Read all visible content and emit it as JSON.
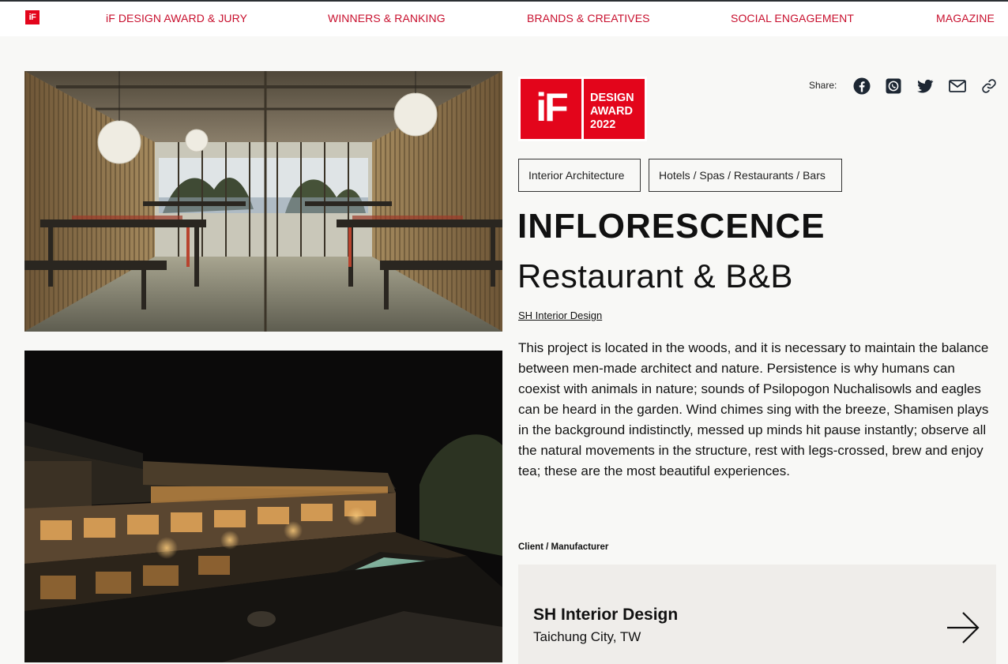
{
  "nav": {
    "logo": "iF",
    "items": [
      {
        "label": "iF DESIGN AWARD & JURY"
      },
      {
        "label": "WINNERS & RANKING"
      },
      {
        "label": "BRANDS & CREATIVES"
      },
      {
        "label": "SOCIAL ENGAGEMENT"
      },
      {
        "label": "MAGAZINE"
      }
    ]
  },
  "award": {
    "mark": "iF",
    "line1": "DESIGN",
    "line2": "AWARD",
    "line3": "2022"
  },
  "share": {
    "label": "Share:",
    "icons": [
      "facebook-icon",
      "whatsapp-icon",
      "twitter-icon",
      "mail-icon",
      "link-icon"
    ]
  },
  "tags": [
    "Interior Architecture",
    "Hotels / Spas / Restaurants / Bars"
  ],
  "project": {
    "title": "INFLORESCENCE",
    "subtitle": "Restaurant & B&B",
    "designer": "SH Interior Design",
    "description": "This project is located in the woods, and it is necessary to maintain the balance between men-made architect and nature. Persistence is why humans can coexist with animals in nature; sounds of Psilopogon Nuchalisowls and eagles can be heard in the garden. Wind chimes sing with the breeze, Shamisen plays in the background indistinctly, messed up minds hit pause instantly; observe all the natural movements in the structure, rest with legs-crossed, brew and enjoy tea; these are the most beautiful experiences."
  },
  "client": {
    "label": "Client / Manufacturer",
    "name": "SH Interior Design",
    "location": "Taichung City, TW"
  },
  "colors": {
    "brand": "#e3051b",
    "nav_link": "#c8102e",
    "background": "#f8f8f6",
    "card": "#efedea"
  }
}
